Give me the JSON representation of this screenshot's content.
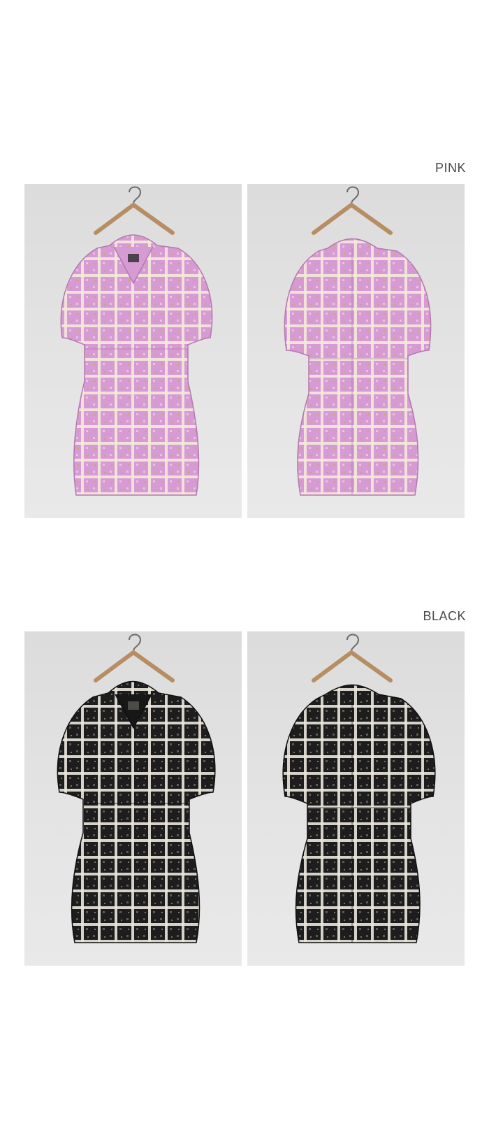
{
  "sections": [
    {
      "label": "PINK",
      "views": [
        "front",
        "back"
      ],
      "colors": {
        "base": "#d79bd3",
        "weave": "#f3e9dc",
        "accent": "#c6a86b"
      }
    },
    {
      "label": "BLACK",
      "views": [
        "front",
        "back"
      ],
      "colors": {
        "base": "#1d1d1d",
        "weave": "#eae6dc",
        "accent": "#7a7367"
      }
    }
  ],
  "icons": {
    "hanger": "hanger-icon"
  }
}
